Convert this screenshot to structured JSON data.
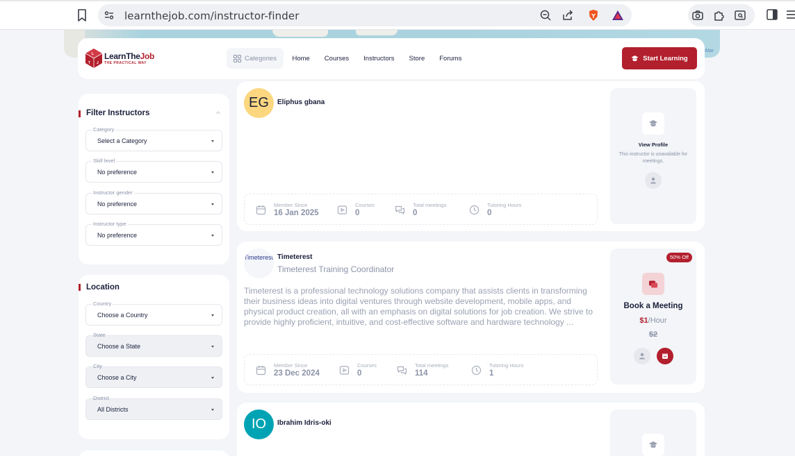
{
  "browser": {
    "url": "learnthejob.com/instructor-finder"
  },
  "map": {
    "credit": "tMar"
  },
  "header": {
    "brand_learn": "Learn",
    "brand_the": "The",
    "brand_job": "Job",
    "tagline": "THE PRACTICAL WAY",
    "nav": {
      "categories": "Categories",
      "home": "Home",
      "courses": "Courses",
      "instructors": "Instructors",
      "store": "Store",
      "forums": "Forums"
    },
    "start_label": "Start Learning"
  },
  "filter": {
    "title": "Filter Instructors",
    "category": {
      "label": "Category",
      "value": "Select a Category"
    },
    "skill": {
      "label": "Skill level",
      "value": "No preference"
    },
    "gender": {
      "label": "Instructor gender",
      "value": "No preference"
    },
    "type": {
      "label": "Instructor type",
      "value": "No preference"
    }
  },
  "location": {
    "title": "Location",
    "country": {
      "label": "Country",
      "value": "Choose a Country"
    },
    "state": {
      "label": "State",
      "value": "Choose a State"
    },
    "city": {
      "label": "City",
      "value": "Choose a City"
    },
    "district": {
      "label": "District",
      "value": "All Districts"
    }
  },
  "instructors": [
    {
      "initials": "EG",
      "name": "Eliphus gbana",
      "stats": {
        "member_since_label": "Member Since",
        "member_since": "16 Jan 2025",
        "courses_label": "Courses",
        "courses": "0",
        "meetings_label": "Total meetings",
        "meetings": "0",
        "hours_label": "Tutoring Hours",
        "hours": "0"
      },
      "panel": {
        "title": "View Profile",
        "note": "This instructor is unavailable for meetings."
      }
    },
    {
      "logo_alt": "Timeterest",
      "name": "Timeterest",
      "role": "Timeterest Training Coordinator",
      "description": "Timeterest is a professional technology solutions company that assists clients in transforming their business ideas into digital ventures through website development, mobile apps, and physical product creation, all with an emphasis on digital solutions for job creation. We strive to provide highly proficient, intuitive, and cost-effective software and hardware technology ...",
      "stats": {
        "member_since_label": "Member Since",
        "member_since": "23 Dec 2024",
        "courses_label": "Courses",
        "courses": "0",
        "meetings_label": "Total meetings",
        "meetings": "114",
        "hours_label": "Tutoring Hours",
        "hours": "1"
      },
      "panel": {
        "badge": "50% Off",
        "title": "Book a Meeting",
        "price": "$1",
        "per": "/Hour",
        "old_price": "$2"
      }
    },
    {
      "initials": "IO",
      "name": "Ibrahim Idris-oki"
    }
  ],
  "colors": {
    "accent": "#b21f2d",
    "navy": "#1b1f3b",
    "eg_avatar": "#fcd77f",
    "io_avatar": "#00a3b4"
  }
}
